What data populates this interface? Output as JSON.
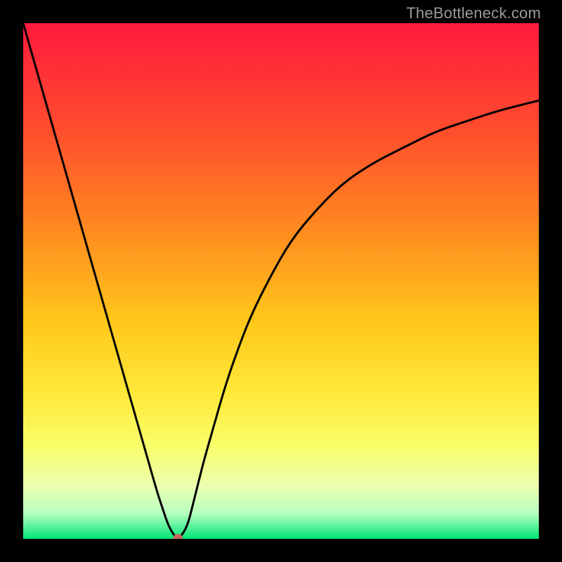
{
  "watermark": "TheBottleneck.com",
  "chart_data": {
    "type": "line",
    "title": "",
    "xlabel": "",
    "ylabel": "",
    "xlim": [
      0,
      100
    ],
    "ylim": [
      0,
      100
    ],
    "grid": false,
    "legend": false,
    "gradient_stops": [
      {
        "offset": 0.0,
        "color": "#ff1a3c"
      },
      {
        "offset": 0.2,
        "color": "#ff4b2e"
      },
      {
        "offset": 0.4,
        "color": "#ff8a1f"
      },
      {
        "offset": 0.58,
        "color": "#ffc81a"
      },
      {
        "offset": 0.72,
        "color": "#ffe93a"
      },
      {
        "offset": 0.82,
        "color": "#f8ff6a"
      },
      {
        "offset": 0.9,
        "color": "#e9ffb0"
      },
      {
        "offset": 0.95,
        "color": "#b8ffc0"
      },
      {
        "offset": 1.0,
        "color": "#00e676"
      }
    ],
    "series": [
      {
        "name": "bottleneck-curve",
        "x": [
          0,
          2,
          4,
          6,
          8,
          10,
          12,
          14,
          16,
          18,
          20,
          22,
          24,
          26,
          27,
          28,
          29,
          30,
          31,
          32,
          33,
          34,
          35,
          37,
          39,
          41,
          44,
          48,
          52,
          57,
          62,
          68,
          74,
          80,
          86,
          92,
          100
        ],
        "y": [
          100,
          93,
          86,
          79,
          72,
          65,
          58,
          51,
          44,
          37,
          30,
          23,
          16,
          9,
          6,
          3,
          1,
          0,
          1,
          3,
          7,
          11,
          15,
          22,
          29,
          35,
          43,
          51,
          58,
          64,
          69,
          73,
          76,
          79,
          81,
          83,
          85
        ]
      }
    ],
    "marker": {
      "x": 30,
      "y": 0,
      "color": "#c36b5b",
      "radius": 7
    }
  }
}
